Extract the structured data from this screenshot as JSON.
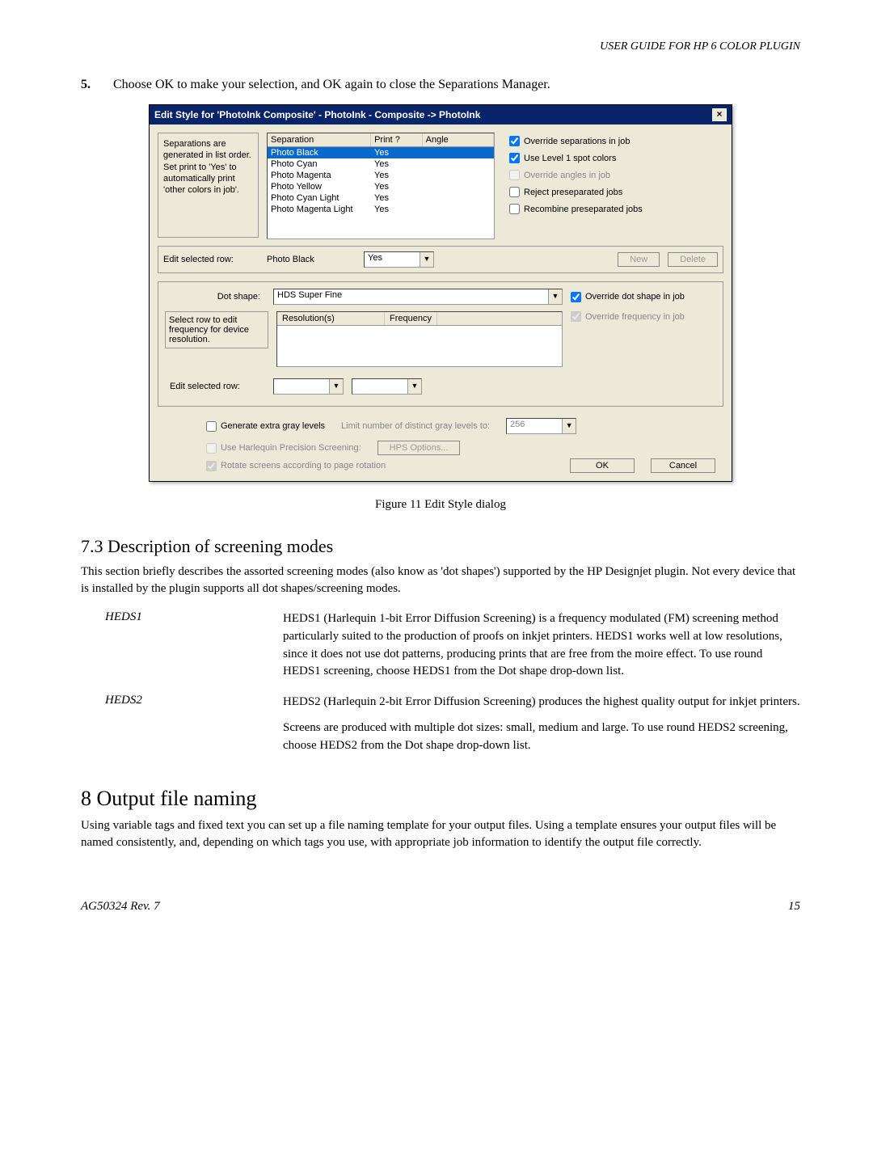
{
  "header": "USER GUIDE FOR HP 6 COLOR PLUGIN",
  "step": {
    "num": "5.",
    "text": "Choose OK to make your selection, and OK again to close the Separations Manager."
  },
  "dialog": {
    "title": "Edit Style for 'PhotoInk Composite' - PhotoInk - Composite -> PhotoInk",
    "close": "×",
    "desc": "Separations are generated in list order. Set print to 'Yes' to automatically print 'other colors in job'.",
    "list": {
      "h1": "Separation",
      "h2": "Print ?",
      "h3": "Angle",
      "rows": [
        {
          "sep": "Photo Black",
          "pr": "Yes",
          "an": "",
          "sel": true
        },
        {
          "sep": "Photo Cyan",
          "pr": "Yes",
          "an": ""
        },
        {
          "sep": "Photo Magenta",
          "pr": "Yes",
          "an": ""
        },
        {
          "sep": "Photo Yellow",
          "pr": "Yes",
          "an": ""
        },
        {
          "sep": "Photo Cyan Light",
          "pr": "Yes",
          "an": ""
        },
        {
          "sep": "Photo Magenta Light",
          "pr": "Yes",
          "an": ""
        }
      ]
    },
    "opts": {
      "o1": "Override separations in job",
      "o2": "Use Level 1 spot colors",
      "o3": "Override angles in job",
      "o4": "Reject preseparated jobs",
      "o5": "Recombine preseparated jobs"
    },
    "editRow": {
      "label": "Edit selected row:",
      "name": "Photo Black",
      "print": "Yes"
    },
    "btnNew": "New",
    "btnDelete": "Delete",
    "dotShape": {
      "label": "Dot shape:",
      "value": "HDS Super Fine",
      "override": "Override dot shape in job"
    },
    "freq": {
      "h1": "Resolution(s)",
      "h2": "Frequency",
      "desc": "Select row to edit frequency for device resolution.",
      "override": "Override frequency in job"
    },
    "editRow2": "Edit selected row:",
    "gen": "Generate extra gray levels",
    "limit": "Limit number of distinct gray levels to:",
    "limitVal": "256",
    "hps": "Use Harlequin Precision Screening:",
    "hpsBtn": "HPS Options...",
    "rotate": "Rotate screens according to page rotation",
    "ok": "OK",
    "cancel": "Cancel"
  },
  "caption": "Figure 11    Edit Style dialog",
  "s73": {
    "title": "7.3  Description of screening modes",
    "intro": "This section briefly describes the assorted screening modes (also know as 'dot shapes') supported by the HP Designjet plugin. Not every device that is installed by the plugin supports all dot shapes/screening modes.",
    "heds1": {
      "term": "HEDS1",
      "body": "HEDS1 (Harlequin 1-bit Error Diffusion Screening) is a frequency modulated (FM) screening method particularly suited to the production of proofs on inkjet printers. HEDS1 works well at low resolutions, since it does not use dot pat­terns, producing prints that are free from the moire effect. To use round HEDS1 screening, choose HEDS1 from the Dot shape drop-down list."
    },
    "heds2": {
      "term": "HEDS2",
      "b1": "HEDS2 (Harlequin 2-bit Error Diffusion Screening) produces the highest qual­ity output for inkjet printers.",
      "b2": "Screens are produced with multiple dot sizes: small, medium and large. To use round HEDS2 screening, choose HEDS2 from the Dot shape drop-down list."
    }
  },
  "s8": {
    "title": "8  Output file naming",
    "body": "Using variable tags and fixed text you can set up a file naming template for your output files. Using a template ensures your output files will be named consistently, and, depending on which tags you use, with appropriate job information to identify the output file correctly."
  },
  "footer": {
    "left": "AG50324 Rev. 7",
    "right": "15"
  }
}
